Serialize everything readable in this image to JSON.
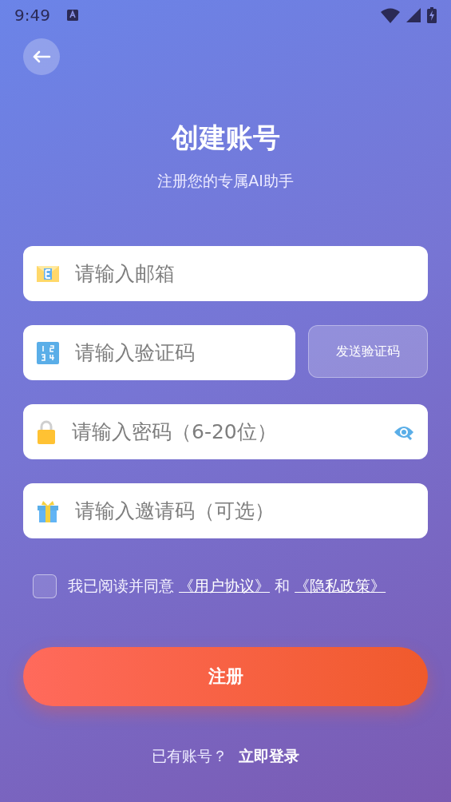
{
  "status_bar": {
    "time": "9:49"
  },
  "header": {
    "title": "创建账号",
    "subtitle": "注册您的专属AI助手"
  },
  "fields": [
    {
      "kind": "email",
      "placeholder": "请输入邮箱"
    },
    {
      "kind": "code",
      "placeholder": "请输入验证码",
      "button": "发送验证码"
    },
    {
      "kind": "password",
      "placeholder": "请输入密码（6-20位）",
      "password_visible": false
    },
    {
      "kind": "invite",
      "placeholder": "请输入邀请码（可选）"
    }
  ],
  "agreement": {
    "checked": false,
    "text": "我已阅读并同意",
    "terms_link": "《用户协议》",
    "joiner": "和",
    "privacy_link": "《隐私政策》"
  },
  "register_button": "注册",
  "footer": {
    "prompt": "已有账号？",
    "login_link": "立即登录"
  }
}
